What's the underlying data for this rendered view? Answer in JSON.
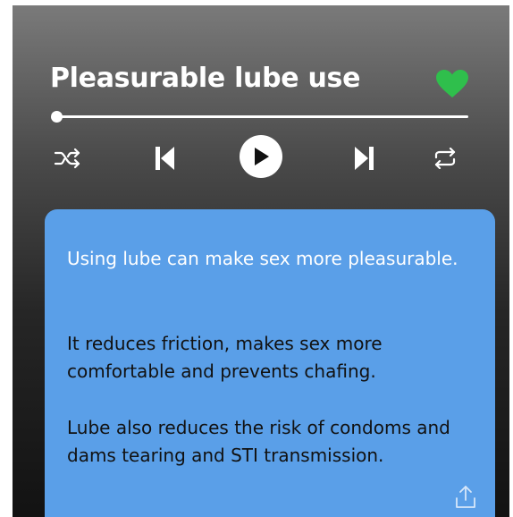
{
  "player": {
    "title": "Pleasurable lube use",
    "liked": true,
    "progress_fraction": 0.0,
    "colors": {
      "heart": "#2fbf4c",
      "card": "#5a9fe8"
    }
  },
  "controls": {
    "shuffle_icon": "shuffle-icon",
    "previous_icon": "skip-previous-icon",
    "play_icon": "play-icon",
    "next_icon": "skip-next-icon",
    "repeat_icon": "repeat-icon"
  },
  "card": {
    "paragraph_1": "Using lube can make sex more pleasurable.",
    "paragraph_2": "It reduces friction, makes sex more comfortable and prevents chafing.",
    "paragraph_3": "Lube also reduces the risk of condoms and dams tearing and STI transmission.",
    "share_icon": "share-icon"
  }
}
